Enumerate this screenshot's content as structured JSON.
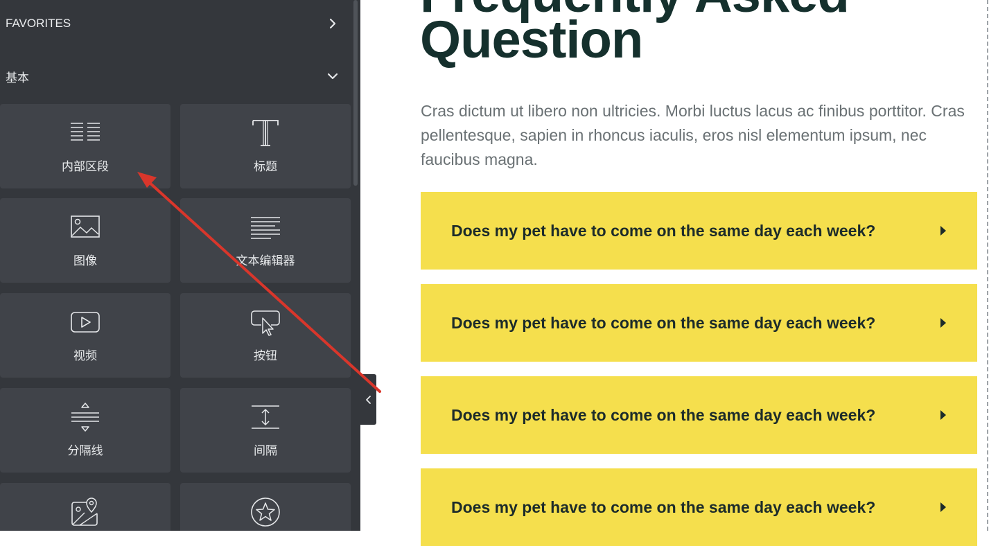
{
  "sidebar": {
    "favorites_label": "FAVORITES",
    "basic_label": "基本",
    "widgets": [
      {
        "label": "内部区段",
        "icon": "inner-section-icon"
      },
      {
        "label": "标题",
        "icon": "heading-icon"
      },
      {
        "label": "图像",
        "icon": "image-icon"
      },
      {
        "label": "文本编辑器",
        "icon": "text-editor-icon"
      },
      {
        "label": "视频",
        "icon": "video-icon"
      },
      {
        "label": "按钮",
        "icon": "button-icon"
      },
      {
        "label": "分隔线",
        "icon": "divider-icon"
      },
      {
        "label": "间隔",
        "icon": "spacer-icon"
      },
      {
        "label": "",
        "icon": "google-maps-icon"
      },
      {
        "label": "",
        "icon": "star-icon"
      }
    ]
  },
  "main": {
    "heading_top": "Frequently Asked",
    "heading": "Question",
    "paragraph": "Cras dictum ut libero non ultricies. Morbi luctus lacus ac finibus porttitor. Cras pellentesque, sapien in rhoncus iaculis, eros nisl elementum ipsum, nec faucibus magna.",
    "faq": [
      {
        "question": "Does my pet have to come on the same day each week?"
      },
      {
        "question": "Does my pet have to come on the same day each week?"
      },
      {
        "question": "Does my pet have to come on the same day each week?"
      },
      {
        "question": "Does my pet have to come on the same day each week?"
      }
    ]
  },
  "colors": {
    "sidebar_bg": "#34373c",
    "widget_bg": "#404349",
    "faq_bg": "#f5df4d",
    "heading": "#15302d",
    "annotation_arrow": "#d9362b"
  }
}
